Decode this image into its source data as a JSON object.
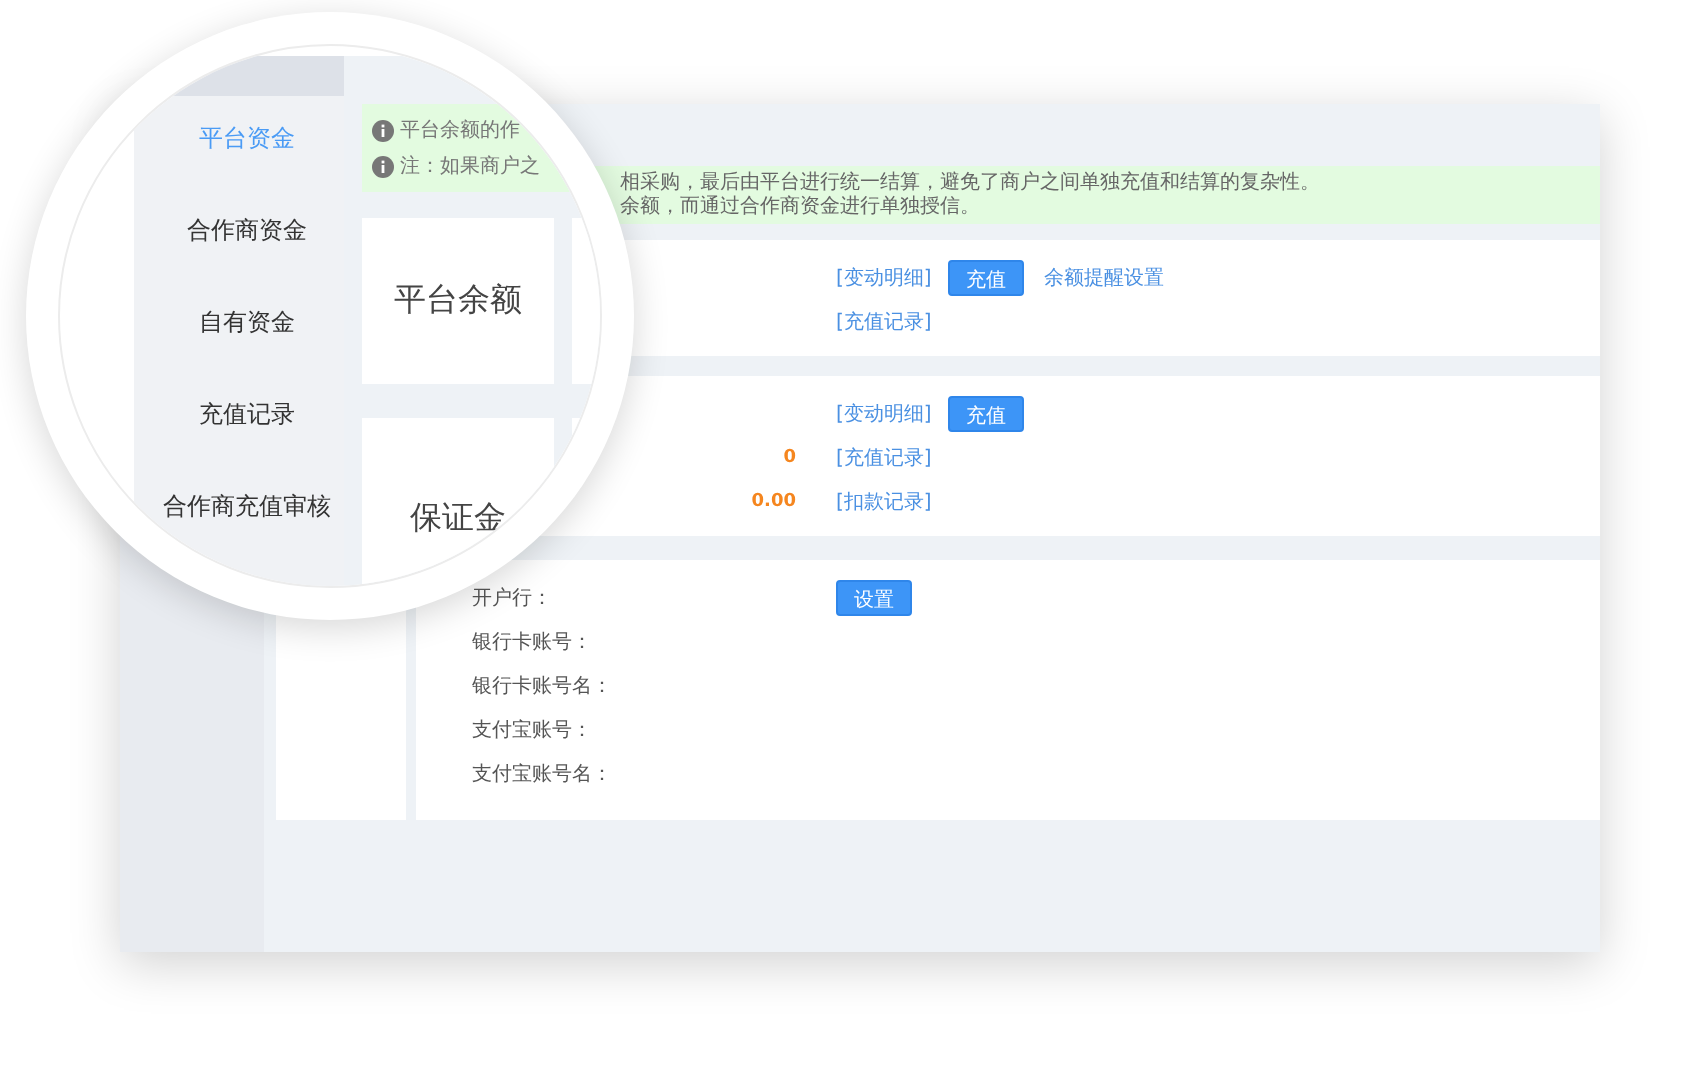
{
  "magnifier": {
    "nav": [
      {
        "label": "平台资金",
        "selected": true
      },
      {
        "label": "合作商资金",
        "selected": false
      },
      {
        "label": "自有资金",
        "selected": false
      },
      {
        "label": "充值记录",
        "selected": false
      },
      {
        "label": "合作商充值审核",
        "selected": false
      }
    ],
    "notice_lines": [
      "平台余额的作",
      "注：如果商户之"
    ],
    "cards": [
      "平台余额",
      "保证金"
    ]
  },
  "notice_lines": [
    "相采购，最后由平台进行统一结算，避免了商户之间单独充值和结算的复杂性。",
    "余额，而通过合作商资金进行单独授信。"
  ],
  "panels": [
    {
      "rows": [
        {
          "actions": [
            {
              "kind": "link",
              "text": "[变动明细]"
            },
            {
              "kind": "button",
              "text": "充值"
            },
            {
              "kind": "plain",
              "text": "余额提醒设置"
            }
          ]
        },
        {
          "actions": [
            {
              "kind": "link",
              "text": "[充值记录]"
            }
          ]
        }
      ]
    },
    {
      "rows": [
        {
          "actions": [
            {
              "kind": "link",
              "text": "[变动明细]"
            },
            {
              "kind": "button",
              "text": "充值"
            }
          ]
        },
        {
          "amount": "0",
          "actions": [
            {
              "kind": "link",
              "text": "[充值记录]"
            }
          ]
        },
        {
          "amount": "0.00",
          "actions": [
            {
              "kind": "link",
              "text": "[扣款记录]"
            }
          ]
        }
      ]
    },
    {
      "rows": [
        {
          "label": "开户行：",
          "actions": [
            {
              "kind": "button",
              "text": "设置"
            }
          ]
        },
        {
          "label": "银行卡账号：",
          "actions": []
        },
        {
          "label": "银行卡账号名：",
          "actions": []
        },
        {
          "label": "支付宝账号：",
          "actions": []
        },
        {
          "label": "支付宝账号名：",
          "actions": []
        }
      ]
    }
  ]
}
